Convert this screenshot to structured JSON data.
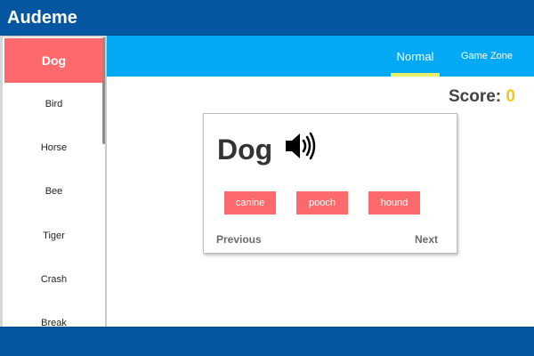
{
  "app": {
    "title": "Audeme"
  },
  "sidebar": {
    "items": [
      {
        "label": "Dog",
        "active": true
      },
      {
        "label": "Bird",
        "active": false
      },
      {
        "label": "Horse",
        "active": false
      },
      {
        "label": "Bee",
        "active": false
      },
      {
        "label": "Tiger",
        "active": false
      },
      {
        "label": "Crash",
        "active": false
      },
      {
        "label": "Break",
        "active": false
      }
    ]
  },
  "tabs": [
    {
      "label": "Normal",
      "active": true
    },
    {
      "label": "Game Zone",
      "active": false
    }
  ],
  "score": {
    "label": "Score:",
    "value": "0"
  },
  "card": {
    "word": "Dog",
    "sound_icon": "speaker-icon",
    "synonyms": [
      "canine",
      "pooch",
      "hound"
    ],
    "previous_label": "Previous",
    "next_label": "Next"
  },
  "colors": {
    "header": "#0456a1",
    "tabbar": "#03a9f4",
    "accent": "#fe6a6b",
    "tab_underline": "#e8f06a",
    "score_value": "#f5c518"
  }
}
